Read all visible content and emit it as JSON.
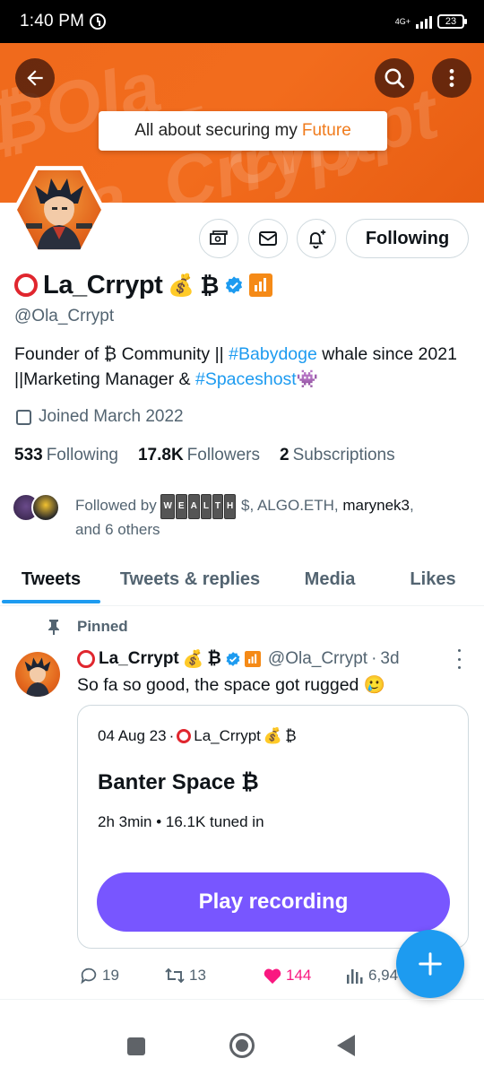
{
  "status_bar": {
    "time": "1:40 PM",
    "network": "4G+",
    "battery": "23"
  },
  "banner": {
    "watermark": "Ola_Crrypt",
    "tagline_prefix": "All about securing my",
    "tagline_accent": "Future",
    "bg_color": "#f26c1d",
    "accent_color": "#f07b1c"
  },
  "header_icons": {
    "back": "arrow-left-icon",
    "search": "search-icon",
    "more": "more-vertical-icon"
  },
  "profile_actions": {
    "monetize": "monetize-icon",
    "message": "message-icon",
    "notify": "notification-plus-icon",
    "following_label": "Following"
  },
  "profile": {
    "display_name": "La_Crrypt",
    "emoji_money": "💰",
    "emoji_btc": "₿",
    "handle": "@Ola_Crrypt",
    "bio_part1": "Founder of ₿ Community || ",
    "bio_hashtag1": "#Babydoge",
    "bio_part2": " whale since 2021 ||Marketing Manager & ",
    "bio_hashtag2": "#Spaceshost",
    "bio_emoji": "👾",
    "joined": "Joined March 2022",
    "following_count": "533",
    "following_label": "Following",
    "followers_count": "17.8K",
    "followers_label": "Followers",
    "subscriptions_count": "2",
    "subscriptions_label": "Subscriptions",
    "followed_by_prefix": "Followed by",
    "followed_by_boxed": "WEALTH",
    "followed_by_rest_plain": " $, ALGO.ETH, ",
    "followed_by_bold": "marynek3",
    "followed_by_suffix": ",",
    "followed_by_others": "and 6 others"
  },
  "tabs": [
    {
      "label": "Tweets",
      "active": true
    },
    {
      "label": "Tweets & replies",
      "active": false
    },
    {
      "label": "Media",
      "active": false
    },
    {
      "label": "Likes",
      "active": false
    }
  ],
  "pinned_tweet": {
    "pinned_label": "Pinned",
    "name": "La_Crrypt",
    "emoji_money": "💰",
    "emoji_btc": "₿",
    "handle": "@Ola_Crrypt",
    "time": "3d",
    "separator": "·",
    "text": "So fa so good, the space got rugged 🥲",
    "space": {
      "date": "04 Aug 23",
      "host": "La_Crrypt",
      "host_money": "💰",
      "host_btc": "₿",
      "title": "Banter Space ₿",
      "stats": "2h 3min • 16.1K tuned in",
      "play_label": "Play recording"
    },
    "replies": "19",
    "retweets": "13",
    "likes": "144",
    "views": "6,94"
  },
  "colors": {
    "twitter_blue": "#1d9bf0",
    "space_purple": "#7856ff",
    "like_pink": "#f91880",
    "muted": "#536471"
  }
}
